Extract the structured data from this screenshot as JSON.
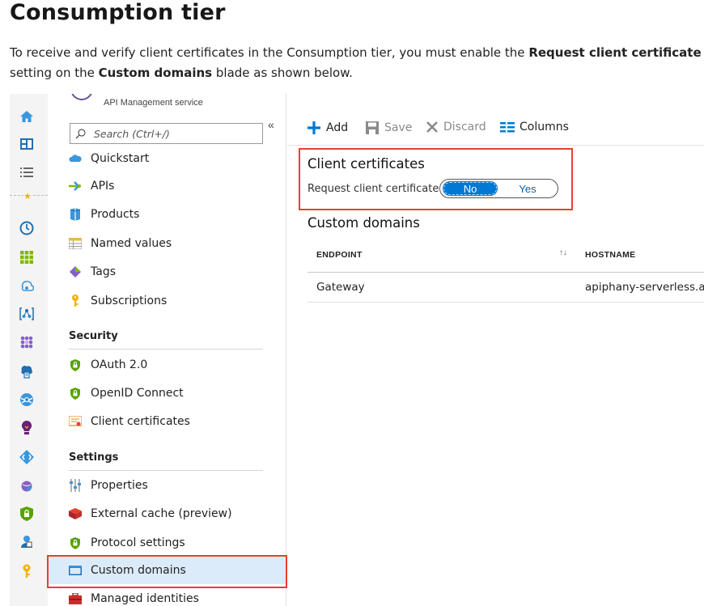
{
  "doc": {
    "title": "Consumption tier",
    "para_1": "To receive and verify client certificates in the Consumption tier, you must enable the ",
    "para_bold_1": "Request client certificate",
    "para_2": " setting on the ",
    "para_bold_2": "Custom domains",
    "para_3": " blade as shown below."
  },
  "service": {
    "subtitle": "API Management service"
  },
  "menu": {
    "search_placeholder": "Search (Ctrl+/)",
    "collapse_glyph": "«",
    "items_top": [
      {
        "label": "Quickstart",
        "icon": "cloud-icon"
      },
      {
        "label": "APIs",
        "icon": "api-arrow-icon"
      },
      {
        "label": "Products",
        "icon": "products-icon"
      },
      {
        "label": "Named values",
        "icon": "table-icon"
      },
      {
        "label": "Tags",
        "icon": "tag-icon"
      },
      {
        "label": "Subscriptions",
        "icon": "key-icon"
      }
    ],
    "security_title": "Security",
    "security_items": [
      {
        "label": "OAuth 2.0",
        "icon": "shield-lock-icon"
      },
      {
        "label": "OpenID Connect",
        "icon": "shield-lock-icon"
      },
      {
        "label": "Client certificates",
        "icon": "certificate-icon"
      }
    ],
    "settings_title": "Settings",
    "settings_items": [
      {
        "label": "Properties",
        "icon": "properties-icon"
      },
      {
        "label": "External cache (preview)",
        "icon": "cache-icon"
      },
      {
        "label": "Protocol settings",
        "icon": "shield-lock-icon"
      },
      {
        "label": "Custom domains",
        "icon": "domain-icon"
      },
      {
        "label": "Managed identities",
        "icon": "toolbox-icon"
      }
    ]
  },
  "toolbar": {
    "add_label": "Add",
    "save_label": "Save",
    "discard_label": "Discard",
    "columns_label": "Columns"
  },
  "client_certificates": {
    "title": "Client certificates",
    "request_label": "Request client certificate",
    "option_no": "No",
    "option_yes": "Yes",
    "selected": "No"
  },
  "custom_domains": {
    "title": "Custom domains",
    "columns": [
      "ENDPOINT",
      "HOSTNAME"
    ],
    "sort_glyph": "↑↓",
    "rows": [
      {
        "endpoint": "Gateway",
        "hostname": "apiphany-serverless.az"
      }
    ]
  },
  "colors": {
    "accent": "#0078d4",
    "highlight_border": "#e8412a",
    "selected_bg": "#dcebfa"
  }
}
